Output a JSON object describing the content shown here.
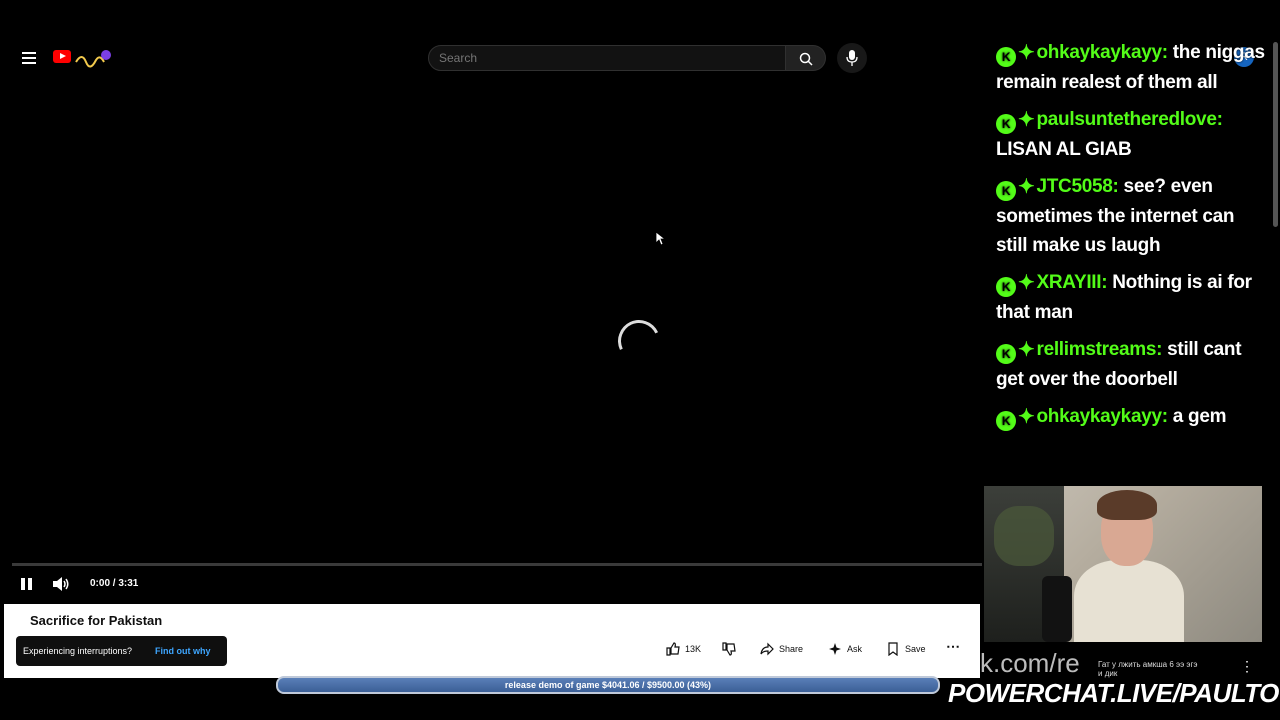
{
  "header": {
    "search_placeholder": "Search",
    "avatar_letter": "R"
  },
  "player": {
    "time_display": "0:00 / 3:31",
    "progress": 0
  },
  "video": {
    "title": "Sacrifice for Pakistan"
  },
  "toast": {
    "text": "Experiencing interruptions?",
    "link": "Find out why"
  },
  "actions": {
    "likes": "13K",
    "share": "Share",
    "ask": "Ask",
    "save": "Save"
  },
  "donation_bar": {
    "text": "release demo of game $4041.06 / $9500.00 (43%)",
    "percent": 43
  },
  "chat": {
    "messages": [
      {
        "user": "ohkaykaykayy:",
        "text": "the niggas remain realest of them all"
      },
      {
        "user": "paulsuntetheredlove:",
        "text": "LISAN AL GIAB"
      },
      {
        "user": "JTC5058:",
        "text": "see? even sometimes the internet can still make us laugh"
      },
      {
        "user": "XRAYIII:",
        "text": "Nothing is ai for that man"
      },
      {
        "user": "rellimstreams:",
        "text": "still cant get over the doorbell"
      },
      {
        "user": "ohkaykaykayy:",
        "text": "a gem"
      }
    ],
    "badge_color": "#53fc18"
  },
  "overlay": {
    "url_fragment": "k.com/re",
    "brand": "POWERCHAT.LIVE/PAULTOWN"
  },
  "colors": {
    "accent_green": "#53fc18",
    "youtube_red": "#ff0000",
    "link_blue": "#3ea6ff"
  }
}
